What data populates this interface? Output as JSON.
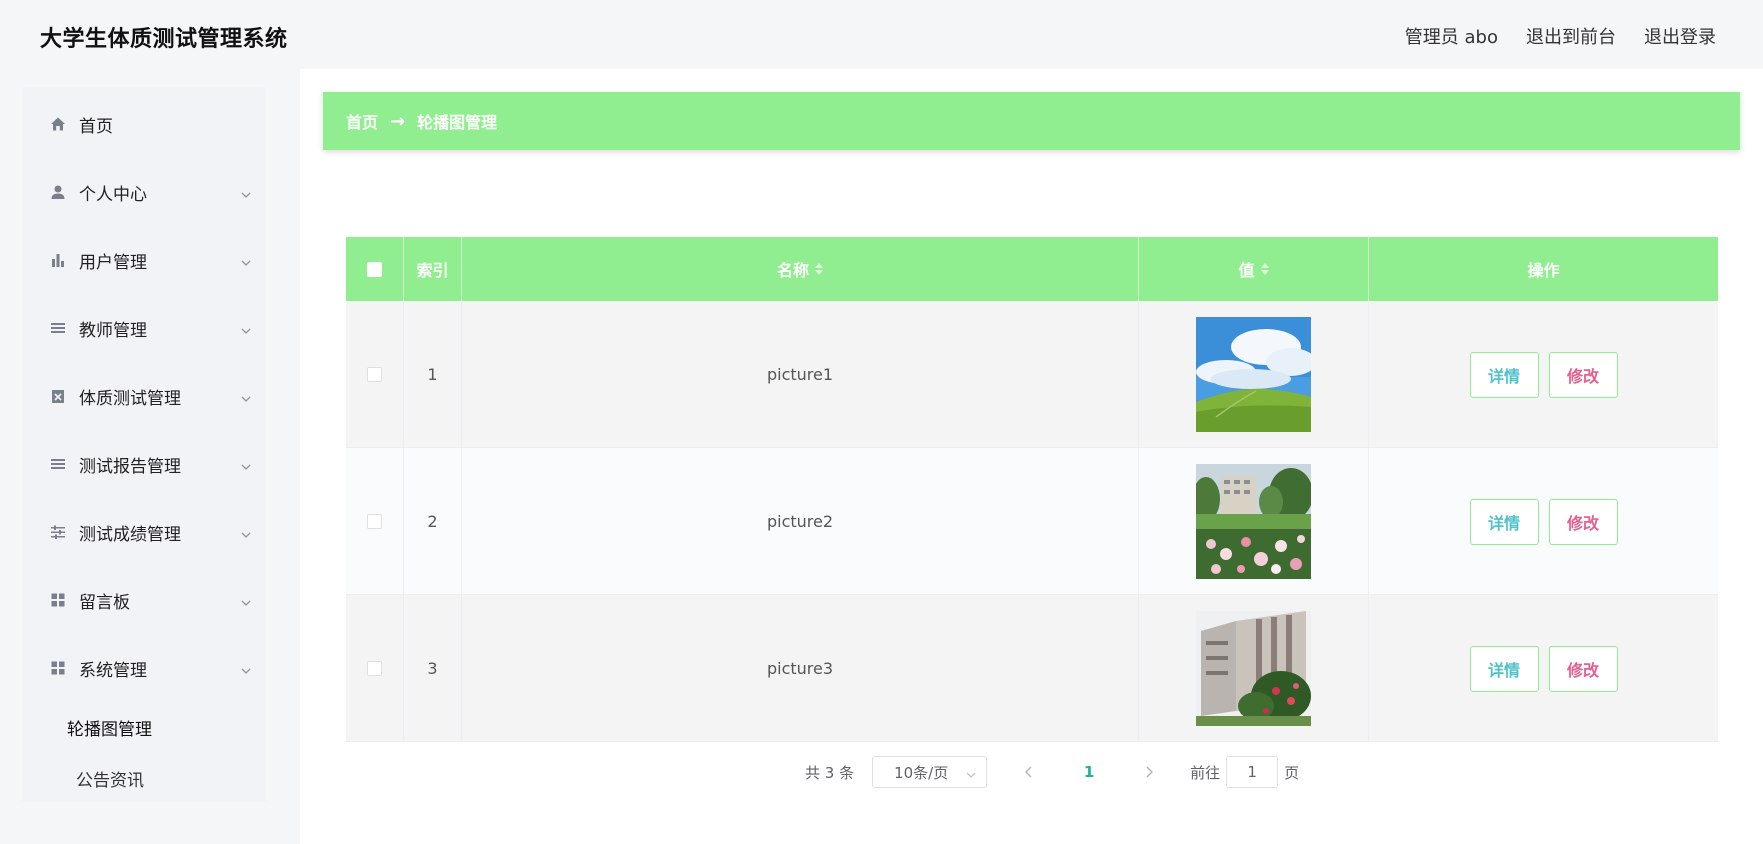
{
  "header": {
    "title": "大学生体质测试管理系统",
    "admin": "管理员 abo",
    "to_front": "退出到前台",
    "logout": "退出登录"
  },
  "sidebar": {
    "items": [
      {
        "label": "首页",
        "icon": "home-icon"
      },
      {
        "label": "个人中心",
        "icon": "user-icon"
      },
      {
        "label": "用户管理",
        "icon": "bar-chart-icon"
      },
      {
        "label": "教师管理",
        "icon": "list-icon"
      },
      {
        "label": "体质测试管理",
        "icon": "clipboard-icon"
      },
      {
        "label": "测试报告管理",
        "icon": "list-icon"
      },
      {
        "label": "测试成绩管理",
        "icon": "sliders-icon"
      },
      {
        "label": "留言板",
        "icon": "grid-icon"
      },
      {
        "label": "系统管理",
        "icon": "grid-icon"
      }
    ],
    "subitems": [
      {
        "label": "轮播图管理",
        "active": true
      },
      {
        "label": "公告资讯",
        "active": false
      }
    ]
  },
  "breadcrumb": {
    "home": "首页",
    "separator": "→",
    "current": "轮播图管理"
  },
  "table": {
    "columns": [
      "索引",
      "名称",
      "值",
      "操作"
    ],
    "rows": [
      {
        "index": "1",
        "name": "picture1",
        "image": "sky-hill-image"
      },
      {
        "index": "2",
        "name": "picture2",
        "image": "campus-flowers-image"
      },
      {
        "index": "3",
        "name": "picture3",
        "image": "building-trees-image"
      }
    ],
    "detail_label": "详情",
    "edit_label": "修改"
  },
  "pagination": {
    "total": "共 3 条",
    "page_size": "10条/页",
    "current": "1",
    "goto_label": "前往",
    "goto_value": "1",
    "page_suffix": "页"
  },
  "colors": {
    "accent": "#90ee90",
    "detail": "#4fc3c9",
    "edit": "#e5608e",
    "pager_active": "#1ab394"
  }
}
